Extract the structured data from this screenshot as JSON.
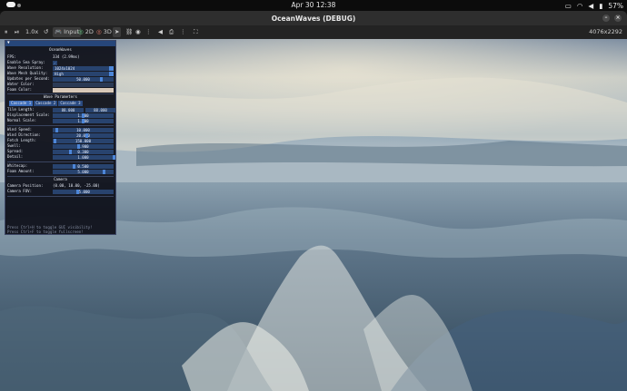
{
  "topbar": {
    "clock": "Apr 30  12:38",
    "battery": "57%"
  },
  "window": {
    "title": "OceanWaves (DEBUG)",
    "close_glyph": "×",
    "resolution": "4076x2292"
  },
  "toolbar": {
    "speed": "1.0x",
    "input": "Input",
    "d2": "2D",
    "d3": "3D"
  },
  "panel": {
    "title": "OceanWaves",
    "fps_label": "FPS:",
    "fps_value": "334 (2.99ms)",
    "sea_spray_label": "Enable Sea Spray:",
    "wave_resolution_label": "Wave Resolution:",
    "wave_resolution_value": "1024x1024",
    "mesh_quality_label": "Wave Mesh Quality:",
    "mesh_quality_value": "High",
    "updates_label": "Updates per Second:",
    "updates_value": "50.000",
    "water_color_label": "Water Color:",
    "foam_color_label": "Foam Color:",
    "wave_params_title": "Wave Parameters",
    "cascades": [
      "Cascade 1",
      "Cascade 2",
      "Cascade 3"
    ],
    "tile_length_label": "Tile Length:",
    "tile_length_x": "88.000",
    "tile_length_y": "88.000",
    "displacement_label": "Displacement Scale:",
    "displacement_value": "1.000",
    "normal_scale_label": "Normal Scale:",
    "normal_scale_value": "1.000",
    "wind_speed_label": "Wind Speed:",
    "wind_speed_value": "10.000",
    "wind_direction_label": "Wind Direction:",
    "wind_direction_value": "20.000",
    "fetch_length_label": "Fetch Length:",
    "fetch_length_value": "150.000",
    "swell_label": "Swell:",
    "swell_value": "0.900",
    "spread_label": "Spread:",
    "spread_value": "0.300",
    "detail_label": "Detail:",
    "detail_value": "1.000",
    "whitecap_label": "Whitecap:",
    "whitecap_value": "0.500",
    "foam_amount_label": "Foam Amount:",
    "foam_amount_value": "5.000",
    "camera_title": "Camera",
    "camera_position_label": "Camera Position:",
    "camera_position_value": "(0.00, 10.00, -25.00)",
    "camera_fov_label": "Camera FOV:",
    "camera_fov_value": "75.000",
    "hint_gui": "Press Ctrl+H to toggle GUI visibility!",
    "hint_fullscreen": "Press Ctrl+F to toggle fullscreen!"
  },
  "colors": {
    "water": "#2b3a55",
    "foam": "#d8c8b8",
    "accent": "#4d86d8"
  }
}
